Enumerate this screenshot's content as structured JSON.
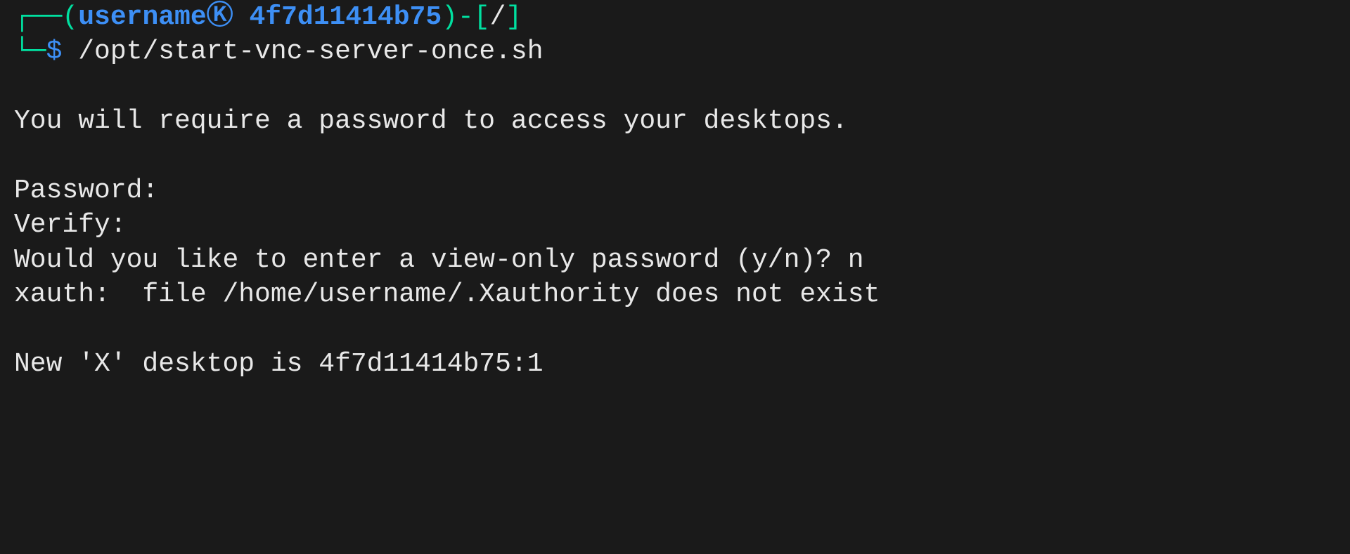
{
  "prompt": {
    "box_top_left": "┌──",
    "open_paren": "(",
    "username": "username",
    "circled_k": "Ⓚ",
    "space": " ",
    "hostname": "4f7d11414b75",
    "close_paren": ")",
    "dash_bracket_open": "-[",
    "path": "/",
    "bracket_close": "]",
    "box_bottom_left": "└─",
    "dollar": "$",
    "command": "/opt/start-vnc-server-once.sh"
  },
  "output": {
    "line1": "You will require a password to access your desktops.",
    "line2": "Password:",
    "line3": "Verify:",
    "line4": "Would you like to enter a view-only password (y/n)? n",
    "line5": "xauth:  file /home/username/.Xauthority does not exist",
    "line6": "New 'X' desktop is 4f7d11414b75:1"
  }
}
